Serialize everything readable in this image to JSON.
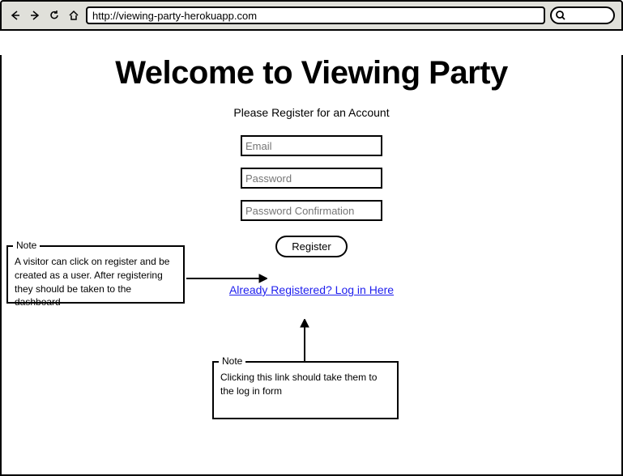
{
  "browser": {
    "url": "http://viewing-party-herokuapp.com"
  },
  "page": {
    "title": "Welcome to Viewing Party",
    "subtitle": "Please Register for an Account"
  },
  "form": {
    "email_placeholder": "Email",
    "password_placeholder": "Password",
    "password_confirm_placeholder": "Password Confirmation",
    "register_button": "Register",
    "login_link": "Already Registered? Log in Here"
  },
  "notes": {
    "legend": "Note",
    "note1": "A visitor can click on register and be created as a user. After registering they should be taken to the dashboard",
    "note2": "Clicking this link should take them to the log in form"
  }
}
